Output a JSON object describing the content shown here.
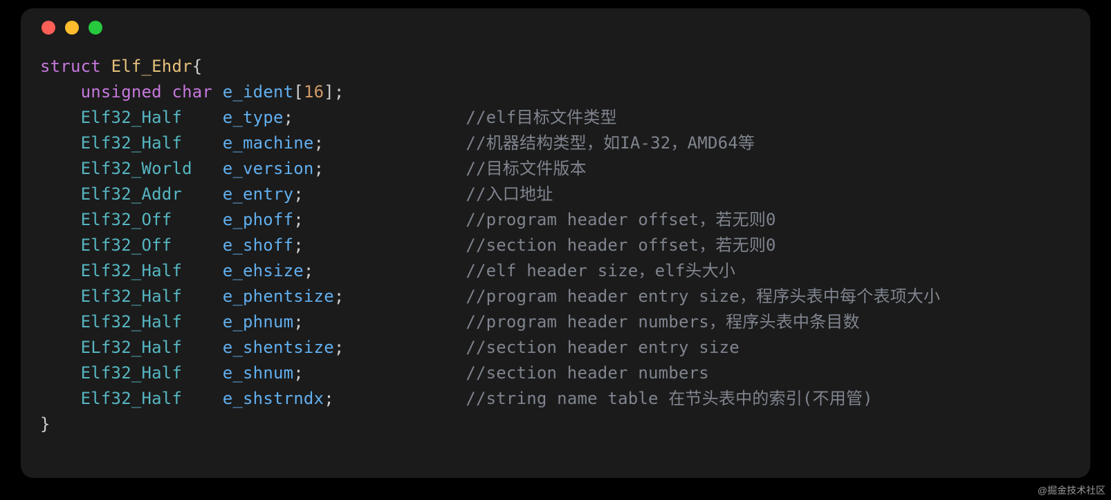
{
  "header": {
    "keyword_struct": "struct",
    "struct_name": "Elf_Ehdr",
    "brace_open": "{",
    "brace_close": "}"
  },
  "first_field": {
    "qual_unsigned": "unsigned",
    "qual_char": "char",
    "name": "e_ident",
    "lbrack": "[",
    "size": "16",
    "rbrack_end": "];"
  },
  "fields": [
    {
      "type": "Elf32_Half",
      "name": "e_type",
      "comment": "//elf目标文件类型"
    },
    {
      "type": "Elf32_Half",
      "name": "e_machine",
      "comment": "//机器结构类型，如IA-32，AMD64等"
    },
    {
      "type": "Elf32_World",
      "name": "e_version",
      "comment": "//目标文件版本"
    },
    {
      "type": "Elf32_Addr",
      "name": "e_entry",
      "comment": "//入口地址"
    },
    {
      "type": "Elf32_Off",
      "name": "e_phoff",
      "comment": "//program header offset，若无则0"
    },
    {
      "type": "Elf32_Off",
      "name": "e_shoff",
      "comment": "//section header offset，若无则0"
    },
    {
      "type": "Elf32_Half",
      "name": "e_ehsize",
      "comment": "//elf header size，elf头大小"
    },
    {
      "type": "Elf32_Half",
      "name": "e_phentsize",
      "comment": "//program header entry size，程序头表中每个表项大小"
    },
    {
      "type": "Elf32_Half",
      "name": "e_phnum",
      "comment": "//program header numbers，程序头表中条目数"
    },
    {
      "type": "ELf32_Half",
      "name": "e_shentsize",
      "comment": "//section header entry size"
    },
    {
      "type": "Elf32_Half",
      "name": "e_shnum",
      "comment": "//section header numbers"
    },
    {
      "type": "Elf32_Half",
      "name": "e_shstrndx",
      "comment": "//string name table 在节头表中的索引(不用管)"
    }
  ],
  "layout": {
    "indent": "    ",
    "type_col_width": 14,
    "name_col_width": 12,
    "comment_col": 42
  },
  "watermark": "@掘金技术社区"
}
